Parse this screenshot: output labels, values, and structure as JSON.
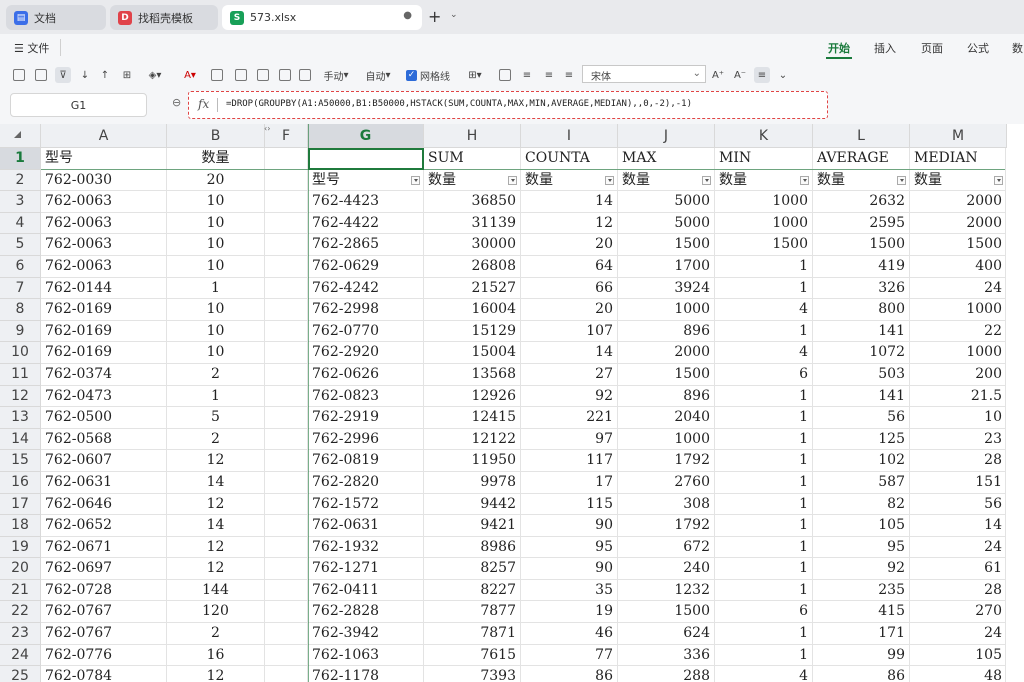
{
  "tabs": [
    {
      "label": "文档",
      "icon": "document-icon",
      "color": "#3b6ee8"
    },
    {
      "label": "找稻壳模板",
      "icon": "template-icon",
      "color": "#e0434a"
    },
    {
      "label": "573.xlsx",
      "icon": "spreadsheet-icon",
      "color": "#18a058",
      "badge": "S",
      "active": true
    }
  ],
  "menu": {
    "file": "文件",
    "ribbon_tabs": [
      "开始",
      "插入",
      "页面",
      "公式",
      "数"
    ]
  },
  "toolbar": {
    "fill_label": "手动",
    "auto_label": "自动",
    "gridlines_label": "网格线",
    "font_name": "宋体"
  },
  "formula_bar": {
    "cell_ref": "G1",
    "fx": "fx",
    "formula": "=DROP(GROUPBY(A1:A50000,B1:B50000,HSTACK(SUM,COUNTA,MAX,MIN,AVERAGE,MEDIAN),,0,-2),-1)"
  },
  "columns": [
    "A",
    "B",
    "F",
    "G",
    "H",
    "I",
    "J",
    "K",
    "L",
    "M"
  ],
  "selected_column": "G",
  "rows": [
    {
      "n": "1",
      "a": "型号",
      "b": "数量",
      "g": "",
      "h": "SUM",
      "i": "COUNTA",
      "j": "MAX",
      "k": "MIN",
      "l": "AVERAGE",
      "m": "MEDIAN"
    },
    {
      "n": "2",
      "a": "762-0030",
      "b": "20",
      "g": "型号",
      "h": "数量",
      "i": "数量",
      "j": "数量",
      "k": "数量",
      "l": "数量",
      "m": "数量"
    },
    {
      "n": "3",
      "a": "762-0063",
      "b": "10",
      "g": "762-4423",
      "h": "36850",
      "i": "14",
      "j": "5000",
      "k": "1000",
      "l": "2632",
      "m": "2000"
    },
    {
      "n": "4",
      "a": "762-0063",
      "b": "10",
      "g": "762-4422",
      "h": "31139",
      "i": "12",
      "j": "5000",
      "k": "1000",
      "l": "2595",
      "m": "2000"
    },
    {
      "n": "5",
      "a": "762-0063",
      "b": "10",
      "g": "762-2865",
      "h": "30000",
      "i": "20",
      "j": "1500",
      "k": "1500",
      "l": "1500",
      "m": "1500"
    },
    {
      "n": "6",
      "a": "762-0063",
      "b": "10",
      "g": "762-0629",
      "h": "26808",
      "i": "64",
      "j": "1700",
      "k": "1",
      "l": "419",
      "m": "400"
    },
    {
      "n": "7",
      "a": "762-0144",
      "b": "1",
      "g": "762-4242",
      "h": "21527",
      "i": "66",
      "j": "3924",
      "k": "1",
      "l": "326",
      "m": "24"
    },
    {
      "n": "8",
      "a": "762-0169",
      "b": "10",
      "g": "762-2998",
      "h": "16004",
      "i": "20",
      "j": "1000",
      "k": "4",
      "l": "800",
      "m": "1000"
    },
    {
      "n": "9",
      "a": "762-0169",
      "b": "10",
      "g": "762-0770",
      "h": "15129",
      "i": "107",
      "j": "896",
      "k": "1",
      "l": "141",
      "m": "22"
    },
    {
      "n": "10",
      "a": "762-0169",
      "b": "10",
      "g": "762-2920",
      "h": "15004",
      "i": "14",
      "j": "2000",
      "k": "4",
      "l": "1072",
      "m": "1000"
    },
    {
      "n": "11",
      "a": "762-0374",
      "b": "2",
      "g": "762-0626",
      "h": "13568",
      "i": "27",
      "j": "1500",
      "k": "6",
      "l": "503",
      "m": "200"
    },
    {
      "n": "12",
      "a": "762-0473",
      "b": "1",
      "g": "762-0823",
      "h": "12926",
      "i": "92",
      "j": "896",
      "k": "1",
      "l": "141",
      "m": "21.5"
    },
    {
      "n": "13",
      "a": "762-0500",
      "b": "5",
      "g": "762-2919",
      "h": "12415",
      "i": "221",
      "j": "2040",
      "k": "1",
      "l": "56",
      "m": "10"
    },
    {
      "n": "14",
      "a": "762-0568",
      "b": "2",
      "g": "762-2996",
      "h": "12122",
      "i": "97",
      "j": "1000",
      "k": "1",
      "l": "125",
      "m": "23"
    },
    {
      "n": "15",
      "a": "762-0607",
      "b": "12",
      "g": "762-0819",
      "h": "11950",
      "i": "117",
      "j": "1792",
      "k": "1",
      "l": "102",
      "m": "28"
    },
    {
      "n": "16",
      "a": "762-0631",
      "b": "14",
      "g": "762-2820",
      "h": "9978",
      "i": "17",
      "j": "2760",
      "k": "1",
      "l": "587",
      "m": "151"
    },
    {
      "n": "17",
      "a": "762-0646",
      "b": "12",
      "g": "762-1572",
      "h": "9442",
      "i": "115",
      "j": "308",
      "k": "1",
      "l": "82",
      "m": "56"
    },
    {
      "n": "18",
      "a": "762-0652",
      "b": "14",
      "g": "762-0631",
      "h": "9421",
      "i": "90",
      "j": "1792",
      "k": "1",
      "l": "105",
      "m": "14"
    },
    {
      "n": "19",
      "a": "762-0671",
      "b": "12",
      "g": "762-1932",
      "h": "8986",
      "i": "95",
      "j": "672",
      "k": "1",
      "l": "95",
      "m": "24"
    },
    {
      "n": "20",
      "a": "762-0697",
      "b": "12",
      "g": "762-1271",
      "h": "8257",
      "i": "90",
      "j": "240",
      "k": "1",
      "l": "92",
      "m": "61"
    },
    {
      "n": "21",
      "a": "762-0728",
      "b": "144",
      "g": "762-0411",
      "h": "8227",
      "i": "35",
      "j": "1232",
      "k": "1",
      "l": "235",
      "m": "28"
    },
    {
      "n": "22",
      "a": "762-0767",
      "b": "120",
      "g": "762-2828",
      "h": "7877",
      "i": "19",
      "j": "1500",
      "k": "6",
      "l": "415",
      "m": "270"
    },
    {
      "n": "23",
      "a": "762-0767",
      "b": "2",
      "g": "762-3942",
      "h": "7871",
      "i": "46",
      "j": "624",
      "k": "1",
      "l": "171",
      "m": "24"
    },
    {
      "n": "24",
      "a": "762-0776",
      "b": "16",
      "g": "762-1063",
      "h": "7615",
      "i": "77",
      "j": "336",
      "k": "1",
      "l": "99",
      "m": "105"
    },
    {
      "n": "25",
      "a": "762-0784",
      "b": "12",
      "g": "762-1178",
      "h": "7393",
      "i": "86",
      "j": "288",
      "k": "4",
      "l": "86",
      "m": "48"
    }
  ]
}
